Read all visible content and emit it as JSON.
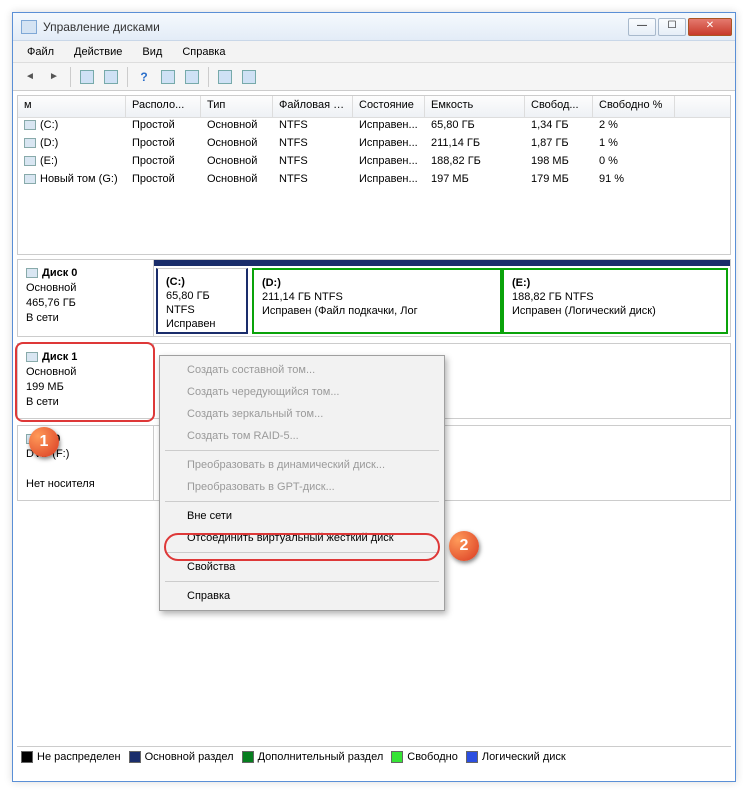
{
  "window": {
    "title": "Управление дисками"
  },
  "menubar": [
    "Файл",
    "Действие",
    "Вид",
    "Справка"
  ],
  "vol_header": {
    "name": "м",
    "layout": "Располо...",
    "type": "Тип",
    "fs": "Файловая с...",
    "status": "Состояние",
    "cap": "Емкость",
    "free": "Свобод...",
    "freep": "Свободно %"
  },
  "volumes": [
    {
      "name": "(C:)",
      "layout": "Простой",
      "type": "Основной",
      "fs": "NTFS",
      "status": "Исправен...",
      "cap": "65,80 ГБ",
      "free": "1,34 ГБ",
      "freep": "2 %"
    },
    {
      "name": "(D:)",
      "layout": "Простой",
      "type": "Основной",
      "fs": "NTFS",
      "status": "Исправен...",
      "cap": "211,14 ГБ",
      "free": "1,87 ГБ",
      "freep": "1 %"
    },
    {
      "name": "(E:)",
      "layout": "Простой",
      "type": "Основной",
      "fs": "NTFS",
      "status": "Исправен...",
      "cap": "188,82 ГБ",
      "free": "198 МБ",
      "freep": "0 %"
    },
    {
      "name": "Новый том (G:)",
      "layout": "Простой",
      "type": "Основной",
      "fs": "NTFS",
      "status": "Исправен...",
      "cap": "197 МБ",
      "free": "179 МБ",
      "freep": "91 %"
    }
  ],
  "disk0": {
    "label": "Диск 0",
    "type": "Основной",
    "size": "465,76 ГБ",
    "state": "В сети",
    "parts": [
      {
        "t": "(C:)",
        "sz": "65,80 ГБ NTFS",
        "st": "Исправен (Система, Загрузк"
      },
      {
        "t": "(D:)",
        "sz": "211,14 ГБ NTFS",
        "st": "Исправен (Файл подкачки, Лог"
      },
      {
        "t": "(E:)",
        "sz": "188,82 ГБ NTFS",
        "st": "Исправен (Логический диск)"
      }
    ]
  },
  "disk1": {
    "label": "Диск 1",
    "type": "Основной",
    "size": "199 МБ",
    "state": "В сети"
  },
  "cdrom": {
    "label": "M 0",
    "drive": "DVD (F:)",
    "state": "Нет носителя"
  },
  "ctx": {
    "items": [
      "Создать составной том...",
      "Создать чередующийся том...",
      "Создать зеркальный том...",
      "Создать том RAID-5...",
      "Преобразовать в динамический диск...",
      "Преобразовать в GPT-диск...",
      "Вне сети",
      "Отсоединить виртуальный жесткий диск",
      "Свойства",
      "Справка"
    ]
  },
  "legend": [
    {
      "c": "#000",
      "t": "Не распределен"
    },
    {
      "c": "#1a2d6b",
      "t": "Основной раздел"
    },
    {
      "c": "#067d1e",
      "t": "Дополнительный раздел"
    },
    {
      "c": "#36e436",
      "t": "Свободно"
    },
    {
      "c": "#2b4ee0",
      "t": "Логический диск"
    }
  ]
}
